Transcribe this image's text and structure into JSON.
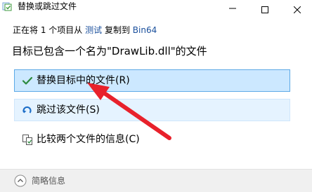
{
  "window": {
    "title": "替换或跳过文件",
    "minimize_icon": "minimize-icon",
    "maximize_icon": "maximize-icon",
    "close_icon": "close-icon"
  },
  "info": {
    "prefix": "正在将 1 个项目从",
    "source": "测试",
    "middle": "复制到",
    "destination": "Bin64"
  },
  "heading": "目标已包含一个名为\"DrawLib.dll\"的文件",
  "options": {
    "replace": {
      "label": "替换目标中的文件(R)",
      "icon": "check-icon",
      "color": "#2b8a3e"
    },
    "skip": {
      "label": "跳过该文件(S)",
      "icon": "skip-arrow-icon",
      "color": "#1e6fc8"
    },
    "compare": {
      "label": "比较两个文件的信息(C)",
      "icon": "compare-files-icon"
    }
  },
  "footer": {
    "label": "简略信息",
    "icon": "chevron-up-icon"
  },
  "annotation": {
    "color": "#e8212b",
    "kind": "red-arrow"
  }
}
